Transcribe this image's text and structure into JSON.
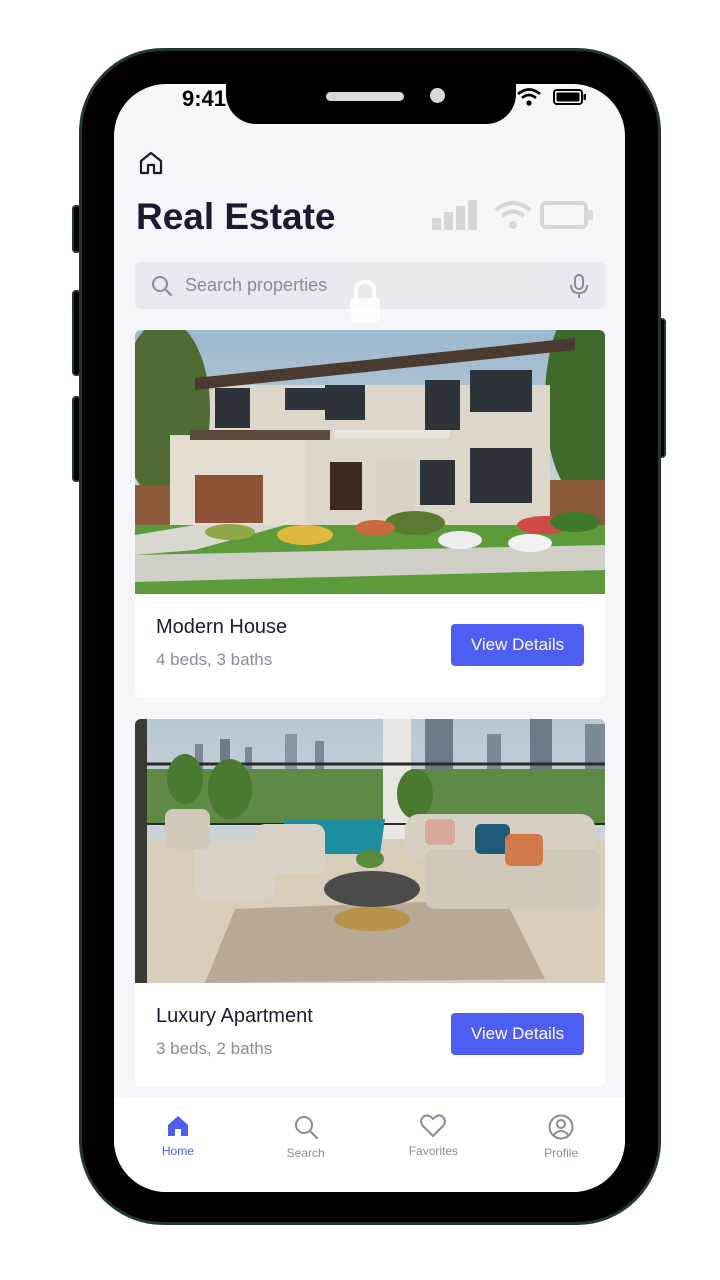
{
  "status": {
    "time": "9:41"
  },
  "header": {
    "title": "Real Estate"
  },
  "search": {
    "placeholder": "Search properties"
  },
  "listings": [
    {
      "title": "Modern House",
      "details": "4 beds, 3 baths",
      "button": "View Details"
    },
    {
      "title": "Luxury Apartment",
      "details": "3 beds, 2 baths",
      "button": "View Details"
    }
  ],
  "nav": [
    {
      "label": "Home",
      "icon": "home-icon",
      "active": true
    },
    {
      "label": "Search",
      "icon": "search-icon",
      "active": false
    },
    {
      "label": "Favorites",
      "icon": "heart-icon",
      "active": false
    },
    {
      "label": "Profile",
      "icon": "profile-icon",
      "active": false
    }
  ],
  "colors": {
    "accent": "#4f5ef2",
    "background": "#f5f5fa",
    "title": "#1a1b33",
    "muted": "#8a8b9b"
  }
}
